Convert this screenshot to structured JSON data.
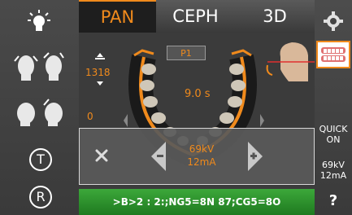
{
  "tabs": [
    {
      "label": "PAN",
      "active": true
    },
    {
      "label": "CEPH",
      "active": false
    },
    {
      "label": "3D",
      "active": false
    }
  ],
  "preview": {
    "program_label": "P1",
    "height_value": "1318",
    "exposure_time": "9.0 s",
    "zero_label": "0"
  },
  "kv_panel": {
    "kv": "69kV",
    "ma": "12mA"
  },
  "right_rail": {
    "quick_on": "QUICK\nON",
    "kv": "69kV",
    "ma": "12mA",
    "help": "?",
    "quick_line1": "QUICK",
    "quick_line2": "ON"
  },
  "left_rail": {
    "t_label": "T",
    "r_label": "R"
  },
  "status_message": ">B>2 : 2:;NG5=8N 87;CG5=8O",
  "colors": {
    "accent": "#f08a1c",
    "status_green": "#2f9a2e"
  }
}
